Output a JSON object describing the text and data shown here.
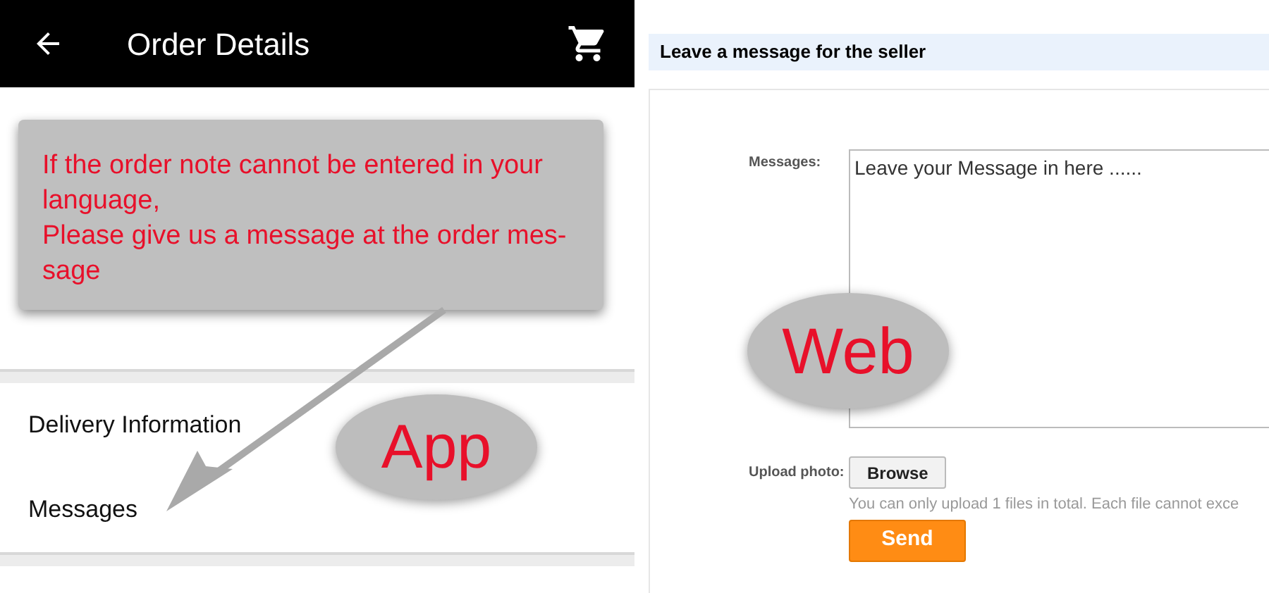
{
  "app": {
    "header": {
      "title": "Order Details"
    },
    "callout": "If the order note cannot be entered in your language,\nPlease give us a message at the order mes-\nsage",
    "rows": [
      {
        "label": "Delivery Information"
      },
      {
        "label": "Messages"
      }
    ],
    "tag": "App"
  },
  "web": {
    "section_title": "Leave a message for the seller",
    "messages_label": "Messages:",
    "messages_field": {
      "value": "Leave your Message in here ......"
    },
    "upload_label": "Upload photo:",
    "browse_button": "Browse",
    "upload_hint": "You can only upload 1 files in total. Each file cannot exce",
    "send_button": "Send",
    "tag": "Web"
  }
}
